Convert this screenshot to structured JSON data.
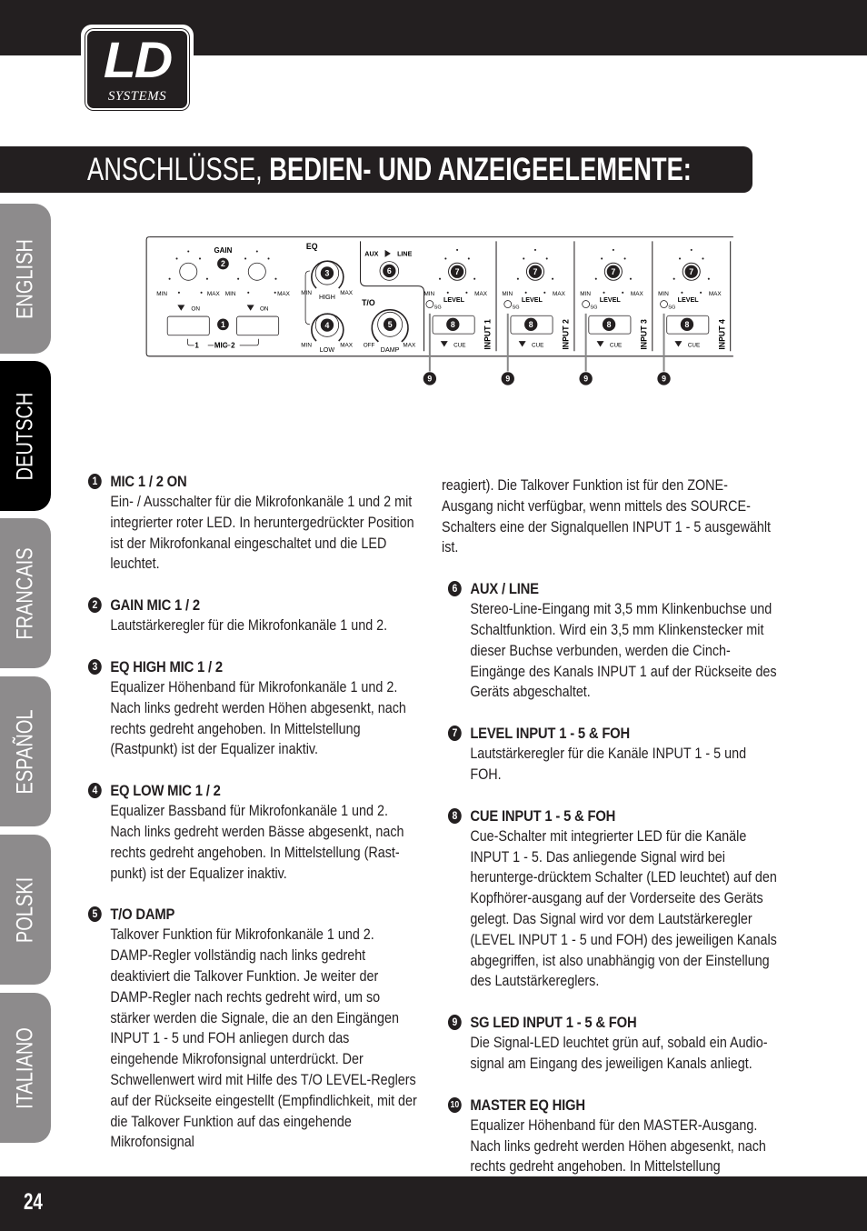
{
  "brand": {
    "logo_main": "LD",
    "logo_sub": "SYSTEMS"
  },
  "header": {
    "title_light": "ANSCHLÜSSE, ",
    "title_bold": "BEDIEN- UND ANZEIGEELEMENTE:"
  },
  "language_tabs": [
    {
      "label": "ENGLISH",
      "active": false
    },
    {
      "label": "DEUTSCH",
      "active": true
    },
    {
      "label": "FRANCAIS",
      "active": false
    },
    {
      "label": "ESPAÑOL",
      "active": false
    },
    {
      "label": "POLSKI",
      "active": false
    },
    {
      "label": "ITALIANO",
      "active": false
    }
  ],
  "diagram": {
    "gain": "GAIN",
    "eq": "EQ",
    "min": "MIN",
    "max": "MAX",
    "on": "ON",
    "mic": "MIC",
    "mic1": "1",
    "mic2": "2",
    "high": "HIGH",
    "low": "LOW",
    "aux_line_left": "AUX",
    "aux_line_right": "LINE",
    "to": "T/O",
    "off": "OFF",
    "damp": "DAMP",
    "level": "LEVEL",
    "sg": "SG",
    "cue": "CUE",
    "inputs": [
      "INPUT 1",
      "INPUT 2",
      "INPUT 3",
      "INPUT 4"
    ],
    "callouts": {
      "n1": "1",
      "n2": "2",
      "n3": "3",
      "n4": "4",
      "n5": "5",
      "n6": "6",
      "n7": "7",
      "n8": "8",
      "n9": "9"
    }
  },
  "left_column": [
    {
      "num": "1",
      "title": "MIC 1 / 2 ON",
      "text": "Ein- / Ausschalter für die Mikrofonkanäle 1 und 2 mit integrierter roter LED. In heruntergedrückter Position ist der Mikrofonkanal eingeschaltet und die LED leuchtet."
    },
    {
      "num": "2",
      "title": "GAIN MIC 1 / 2",
      "text": "Lautstärkeregler für die Mikrofonkanäle 1 und 2."
    },
    {
      "num": "3",
      "title": "EQ HIGH MIC 1 / 2",
      "text": "Equalizer Höhenband für Mikrofonkanäle 1 und 2. Nach links gedreht werden Höhen abgesenkt, nach rechts gedreht angehoben. In Mittelstellung (Rastpunkt) ist der Equalizer inaktiv."
    },
    {
      "num": "4",
      "title": "EQ LOW MIC 1 / 2",
      "text": "Equalizer Bassband für Mikrofonkanäle 1 und 2. Nach links gedreht werden Bässe abgesenkt, nach rechts gedreht angehoben. In Mittelstellung (Rast-punkt) ist der Equalizer inaktiv."
    },
    {
      "num": "5",
      "title": "T/O DAMP",
      "text": "Talkover Funktion für Mikrofonkanäle 1 und 2. DAMP-Regler vollständig nach links gedreht deaktiviert die Talkover Funktion. Je weiter der DAMP-Regler nach rechts gedreht wird, um so stärker werden die Signale, die an den Eingängen INPUT 1 - 5 und FOH anliegen durch das eingehende Mikrofonsignal unterdrückt. Der Schwellenwert wird mit Hilfe des T/O LEVEL-Reglers auf der Rückseite eingestellt (Empfindlichkeit, mit der die Talkover Funktion auf das eingehende Mikrofonsignal"
    }
  ],
  "right_column": {
    "continuation": "reagiert). Die Talkover Funktion ist für den ZONE-Ausgang nicht verfügbar, wenn mittels des SOURCE-Schalters eine der Signalquellen INPUT 1 - 5 ausgewählt ist.",
    "items": [
      {
        "num": "6",
        "title": "AUX / LINE",
        "text": "Stereo-Line-Eingang mit 3,5 mm Klinkenbuchse und Schaltfunktion. Wird ein 3,5 mm Klinkenstecker mit dieser Buchse verbunden, werden die Cinch-Eingänge des Kanals INPUT 1 auf der Rückseite des Geräts abgeschaltet."
      },
      {
        "num": "7",
        "title": "LEVEL INPUT 1 - 5 & FOH",
        "text": "Lautstärkeregler für die Kanäle INPUT 1 - 5 und FOH."
      },
      {
        "num": "8",
        "title": "CUE INPUT 1 - 5 & FOH",
        "text": "Cue-Schalter mit integrierter LED für die Kanäle INPUT 1 - 5. Das anliegende Signal wird bei herunterge-drücktem Schalter (LED leuchtet) auf den Kopfhörer-ausgang auf der Vorderseite des Geräts gelegt. Das Signal wird vor dem Lautstärkeregler (LEVEL INPUT 1 - 5 und FOH) des jeweiligen Kanals abgegriffen, ist also unabhängig von der Einstellung des Lautstärkereglers."
      },
      {
        "num": "9",
        "title": "SG LED INPUT 1 - 5 & FOH",
        "text": "Die Signal-LED leuchtet grün auf, sobald ein Audio-signal am Eingang des jeweiligen Kanals anliegt."
      },
      {
        "num": "10",
        "title": "MASTER EQ HIGH",
        "text": "Equalizer Höhenband für den MASTER-Ausgang. Nach links gedreht werden Höhen abgesenkt, nach rechts gedreht angehoben. In Mittelstellung (Rastpunkt) ist der Equalizer inaktiv."
      }
    ]
  },
  "footer": {
    "page_number": "24"
  }
}
